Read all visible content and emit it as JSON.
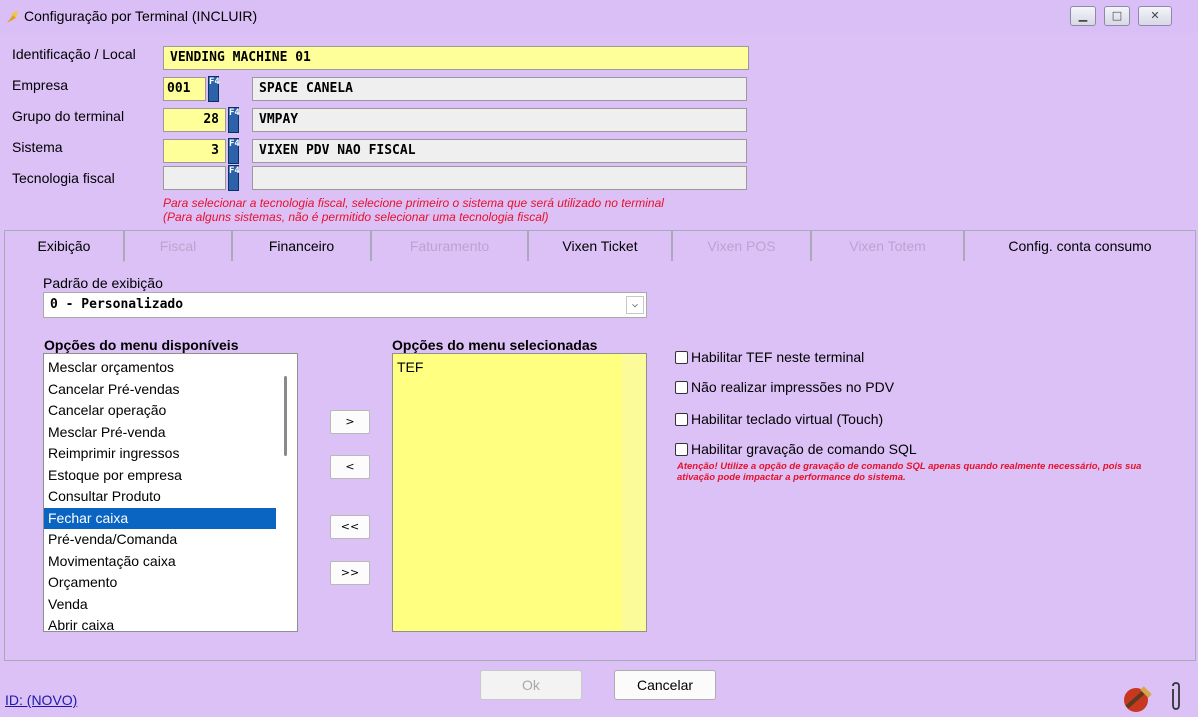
{
  "window": {
    "title": "Configuração por Terminal (INCLUIR)",
    "controls": [
      "minimize-icon",
      "maximize-icon",
      "close-icon"
    ]
  },
  "form": {
    "identificacao": {
      "label": "Identificação / Local",
      "value": "VENDING MACHINE 01"
    },
    "empresa": {
      "label": "Empresa",
      "code": "001",
      "name": "SPACE CANELA"
    },
    "grupo": {
      "label": "Grupo do terminal",
      "code": "28",
      "name": "VMPAY"
    },
    "sistema": {
      "label": "Sistema",
      "code": "3",
      "name": "VIXEN PDV NAO FISCAL"
    },
    "tecnologia": {
      "label": "Tecnologia fiscal",
      "code": "",
      "name": ""
    },
    "f4_key": "F4",
    "hint_line1": "Para selecionar a tecnologia fiscal, selecione primeiro o sistema que será utilizado no terminal",
    "hint_line2": "(Para alguns sistemas, não é permitido selecionar uma tecnologia fiscal)"
  },
  "tabs": [
    {
      "label": "Exibição",
      "state": "active"
    },
    {
      "label": "Fiscal",
      "state": "disabled"
    },
    {
      "label": "Financeiro",
      "state": "enabled"
    },
    {
      "label": "Faturamento",
      "state": "disabled"
    },
    {
      "label": "Vixen Ticket",
      "state": "enabled"
    },
    {
      "label": "Vixen POS",
      "state": "disabled"
    },
    {
      "label": "Vixen Totem",
      "state": "disabled"
    },
    {
      "label": "Config. conta consumo",
      "state": "enabled"
    }
  ],
  "exibicao": {
    "padrao_label": "Padrão de exibição",
    "padrao_value": "0 - Personalizado",
    "disponiveis_title": "Opções do menu disponíveis",
    "disponiveis": [
      "Mesclar orçamentos",
      "Cancelar Pré-vendas",
      "Cancelar operação",
      "Mesclar Pré-venda",
      "Reimprimir ingressos",
      "Estoque por empresa",
      "Consultar Produto",
      "Fechar caixa",
      "Pré-venda/Comanda",
      "Movimentação caixa",
      "Orçamento",
      "Venda",
      "Abrir caixa"
    ],
    "selected_item": "Fechar caixa",
    "selecionadas_title": "Opções do menu selecionadas",
    "selecionadas": [
      "TEF"
    ],
    "move_buttons": {
      "add": ">",
      "remove": "<",
      "remove_all": "<<",
      "add_all": ">>"
    },
    "options": [
      {
        "label": "Habilitar TEF neste terminal",
        "checked": false
      },
      {
        "label": "Não realizar impressões no PDV",
        "checked": false
      },
      {
        "label": "Habilitar teclado virtual (Touch)",
        "checked": false
      },
      {
        "label": "Habilitar gravação de comando SQL",
        "checked": false
      }
    ],
    "warning": "Atenção! Utilize a opção de gravação de comando SQL apenas quando realmente necessário, pois sua ativação pode impactar a performance do sistema."
  },
  "footer": {
    "id_link": "ID: (NOVO)",
    "ok_label": "Ok",
    "cancel_label": "Cancelar"
  }
}
